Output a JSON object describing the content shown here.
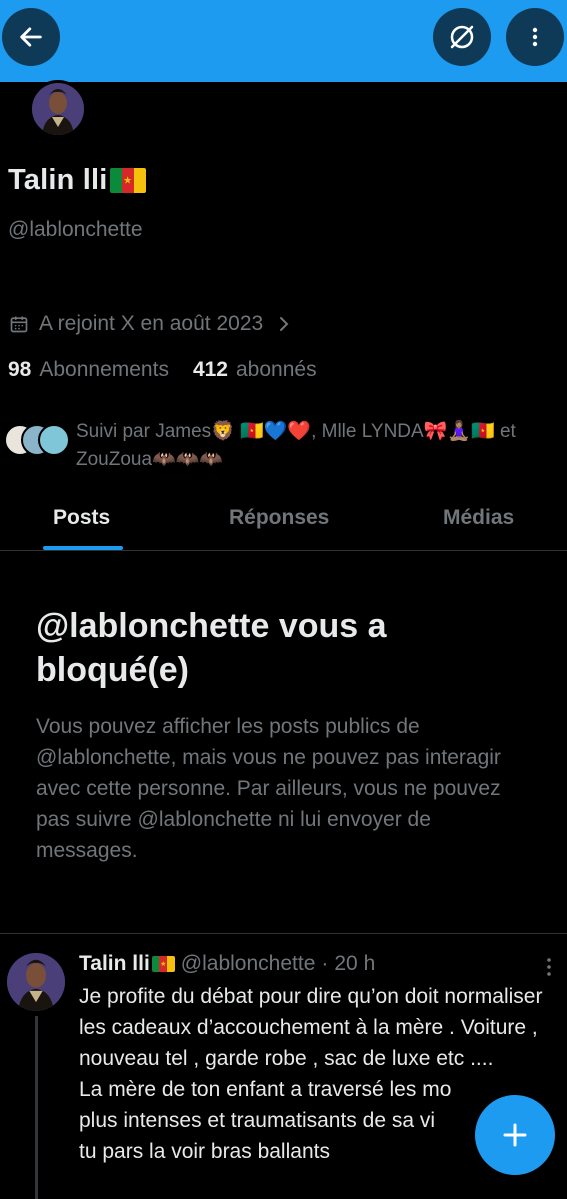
{
  "header": {
    "back_icon": "arrow-left-icon",
    "unblock_icon": "slashed-circle-icon",
    "more_icon": "more-vertical-icon"
  },
  "profile": {
    "name": "Talin lli",
    "handle": "@lablonchette",
    "joined": "A rejoint X en août 2023",
    "following_count": "98",
    "following_label": "Abonnements",
    "followers_count": "412",
    "followers_label": "abonnés",
    "followed_by_line1": "Suivi par James🦁 🇨🇲💙❤️, Mlle LYNDA🎀🧘🏽‍♀️🇨🇲 et",
    "followed_by_line2": "ZouZoua🦇🦇🦇"
  },
  "tabs": [
    {
      "label": "Posts",
      "active": true
    },
    {
      "label": "Réponses",
      "active": false
    },
    {
      "label": "Médias",
      "active": false
    }
  ],
  "blocked": {
    "title": "@lablonchette vous a bloqué(e)",
    "body": "Vous pouvez afficher les posts publics de @lablonchette, mais vous ne pouvez pas interagir avec cette personne. Par ailleurs, vous ne pouvez pas suivre @lablonchette ni lui envoyer de messages."
  },
  "post": {
    "author": "Talin lli",
    "handle": "@lablonchette",
    "time": "20 h",
    "separator": "·",
    "text": "Je profite du débat pour dire qu’on doit normaliser les cadeaux d’accouchement à la mère . Voiture , nouveau tel , garde robe , sac de luxe etc ....\nLa mère de ton enfant a traversé les mo\nplus intenses et traumatisants de sa vi\ntu pars la voir bras ballants"
  },
  "fab": {
    "icon": "plus-icon"
  },
  "colors": {
    "accent": "#1d9bf0",
    "background": "#000000",
    "text_primary": "#e7e9ea",
    "text_secondary": "#71767b"
  }
}
